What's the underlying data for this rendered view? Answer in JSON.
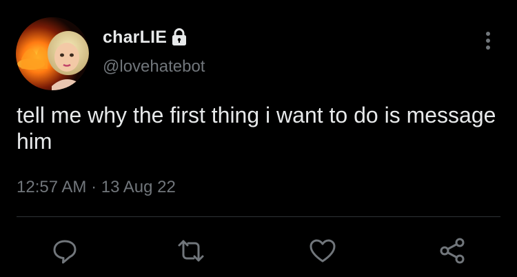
{
  "user": {
    "display_name": "charLIE",
    "handle": "@lovehatebot",
    "protected_icon": "lock-icon",
    "avatar_icon": "avatar-doll-fire"
  },
  "tweet": {
    "text": "tell me why the first thing i want to do is message him",
    "timestamp": "12:57 AM · 13 Aug 22"
  },
  "actions": {
    "reply_icon": "reply-icon",
    "retweet_icon": "retweet-icon",
    "like_icon": "heart-icon",
    "share_icon": "share-icon",
    "more_icon": "more-vertical-icon"
  },
  "colors": {
    "background": "#000000",
    "primary_text": "#e7e9ea",
    "secondary_text": "#71767b",
    "divider": "#2f3336"
  }
}
